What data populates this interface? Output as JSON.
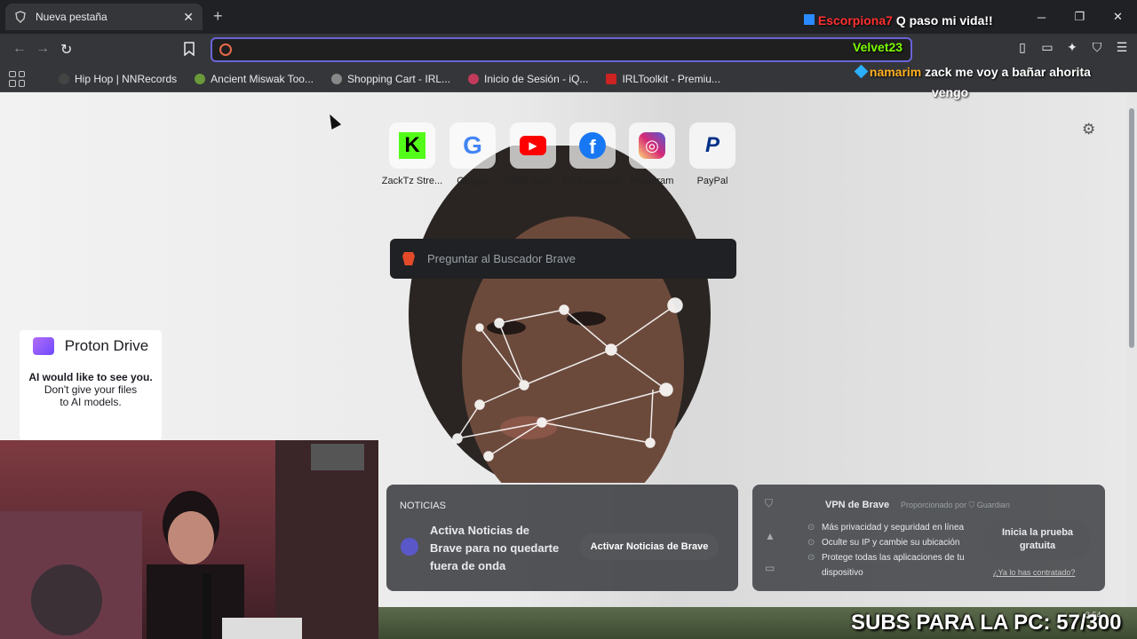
{
  "tab": {
    "title": "Nueva pestaña",
    "close_glyph": "✕"
  },
  "window_controls": {
    "minimize": "─",
    "maximize": "❐",
    "close": "✕"
  },
  "toolbar": {
    "back": "←",
    "forward": "→",
    "reload": "↻",
    "address_value": ""
  },
  "bookmarks": [
    {
      "label": "Hip Hop | NNRecords",
      "icon": "nnrecords-icon",
      "color": "#444444"
    },
    {
      "label": "Ancient Miswak Too...",
      "icon": "miswak-icon",
      "color": "#6a9a3a"
    },
    {
      "label": "Shopping Cart - IRL...",
      "icon": "globe-icon",
      "color": "#888888"
    },
    {
      "label": "Inicio de Sesión - iQ...",
      "icon": "iq-icon",
      "color": "#c23a5a"
    },
    {
      "label": "IRLToolkit - Premiu...",
      "icon": "irltoolkit-icon",
      "color": "#cc2222"
    }
  ],
  "shortcuts": [
    {
      "label": "ZackTz Stre...",
      "icon": "kick-icon",
      "color": "#53fc18",
      "glyph": "K"
    },
    {
      "label": "Google",
      "icon": "google-icon",
      "color": "#4285f4",
      "glyph": "G"
    },
    {
      "label": "(386) YouT...",
      "icon": "youtube-icon",
      "color": "#ff0000",
      "glyph": "▶"
    },
    {
      "label": "(7) Facebook",
      "icon": "facebook-icon",
      "color": "#1877f2",
      "glyph": "f"
    },
    {
      "label": "Instagram",
      "icon": "instagram-icon",
      "color": "#d62976",
      "glyph": "◎"
    },
    {
      "label": "PayPal",
      "icon": "paypal-icon",
      "color": "#003087",
      "glyph": "P"
    }
  ],
  "search": {
    "placeholder": "Preguntar al Buscador Brave"
  },
  "proton": {
    "brand": "Proton Drive",
    "line1": "AI would like to see you.",
    "line2": "Don't give your files",
    "line3": "to AI models."
  },
  "news": {
    "title": "NOTICIAS",
    "text": "Activa Noticias de Brave para no quedarte fuera de onda",
    "button": "Activar Noticias de Brave"
  },
  "vpn": {
    "title": "VPN de Brave",
    "provided_by": "Proporcionado por ⛉ Guardian",
    "features": [
      "Más privacidad y seguridad en línea",
      "Oculte su IP y cambie su ubicación",
      "Protege todas las aplicaciones de tu dispositivo"
    ],
    "cta": "Inicia la prueba gratuita",
    "link": "¿Ya lo has contratado?"
  },
  "chat": [
    {
      "user": "Escorpiona7",
      "message": "Q paso mi vida!!",
      "user_color": "#ff3030"
    },
    {
      "user": "Velvet23",
      "message": "",
      "user_color": "#7cfc00"
    },
    {
      "user": "namarim",
      "message": "zack me voy a bañar ahorita",
      "message_cont": "vengo",
      "user_color": "#ffb020"
    }
  ],
  "overlay": {
    "subs_text": "SUBS PARA LA PC: 57/300",
    "clock": "3:54"
  },
  "colors": {
    "accent": "#6a64d8",
    "brave": "#e24a2a"
  }
}
